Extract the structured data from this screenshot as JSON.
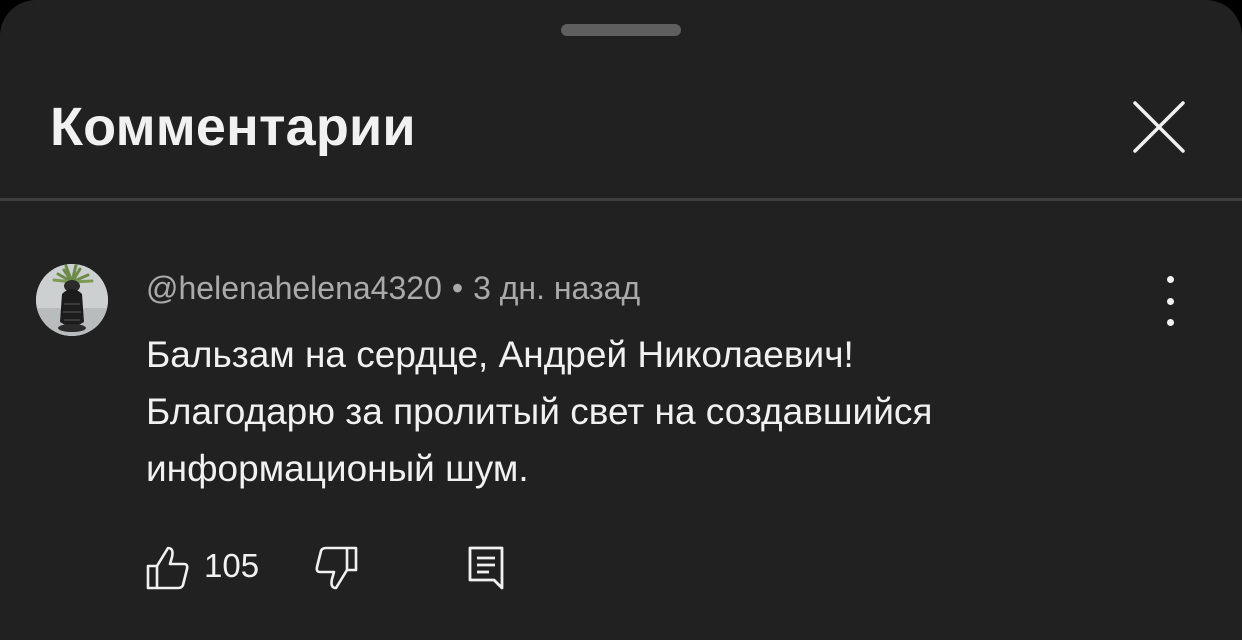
{
  "panel": {
    "title": "Комментарии",
    "close_icon": "close-icon"
  },
  "comment": {
    "author": "@helenahelena4320",
    "separator": "•",
    "time": "3 дн. назад",
    "text": "Бальзам на сердце, Андрей Николаевич!\nБлагодарю за пролитый свет на  создавшийся\nинформационый шум.",
    "like_count": "105",
    "icons": {
      "avatar": "avatar-image",
      "menu": "more-vertical-icon",
      "like": "thumbs-up-icon",
      "dislike": "thumbs-down-icon",
      "reply": "reply-icon"
    }
  },
  "colors": {
    "background": "#212121",
    "text_primary": "#f1f1f1",
    "text_secondary": "#aaaaaa",
    "divider": "#3e3e3e"
  }
}
